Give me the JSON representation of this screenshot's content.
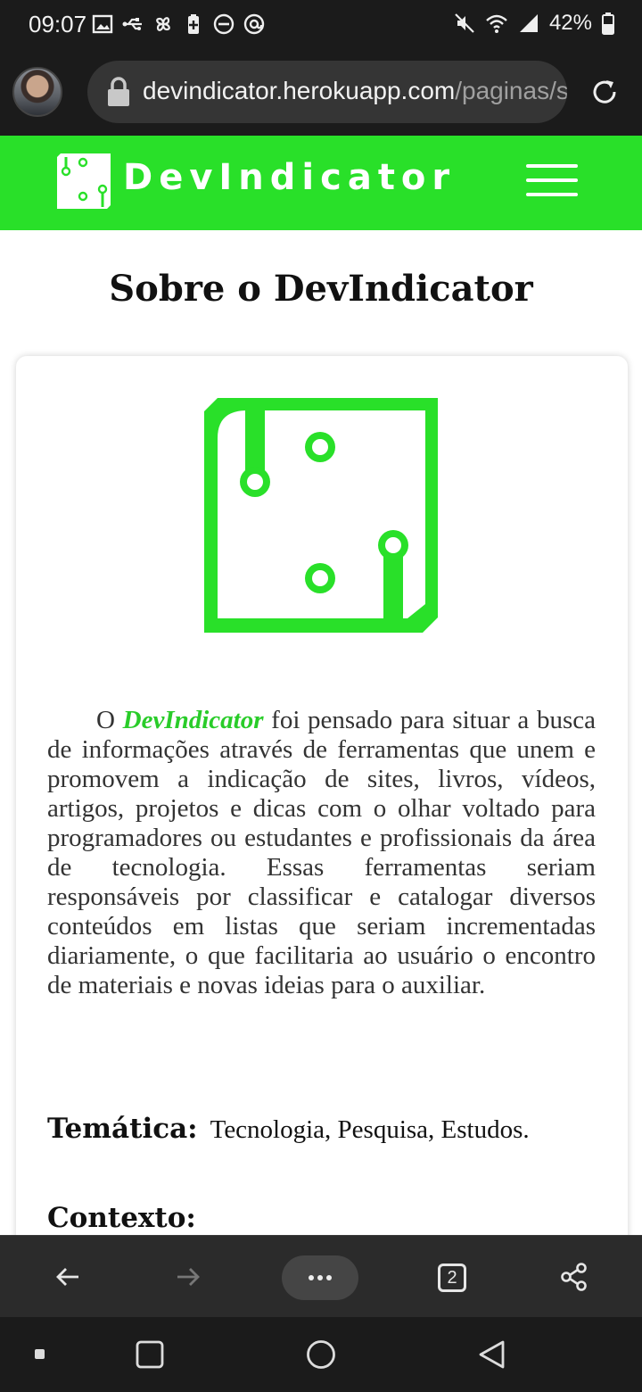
{
  "status_bar": {
    "time": "09:07",
    "battery": "42%",
    "left_icons": [
      "gallery-icon",
      "usb-icon",
      "pinwheel-icon",
      "battery-saver-icon",
      "do-not-disturb-icon",
      "at-sign-icon"
    ],
    "right_icons": [
      "mute-icon",
      "wifi-icon",
      "signal-icon",
      "battery-icon"
    ]
  },
  "browser": {
    "url_host": "devindicator.herokuapp.com",
    "url_path": "/paginas/s",
    "tab_count": "2"
  },
  "site": {
    "brand": "DevIndicator",
    "accent_color": "#29e029"
  },
  "page": {
    "title": "Sobre o DevIndicator",
    "description_prefix": "O ",
    "description_brand": "DevIndicator",
    "description_body": " foi pensado para situar a busca de informações através de ferramentas que unem e promovem a indicação de sites, livros, vídeos, artigos, projetos e dicas com o olhar voltado para programadores ou estudantes e profissionais da área de tecnologia. Essas ferramentas seriam responsáveis por classificar e catalogar diversos conteúdos em listas que seriam incrementadas diariamente, o que facilitaria ao usuário o encontro de materiais e novas ideias para o auxiliar.",
    "thematic_label": "Temática:",
    "thematic_value": "Tecnologia, Pesquisa, Estudos.",
    "context_label": "Contexto:"
  }
}
